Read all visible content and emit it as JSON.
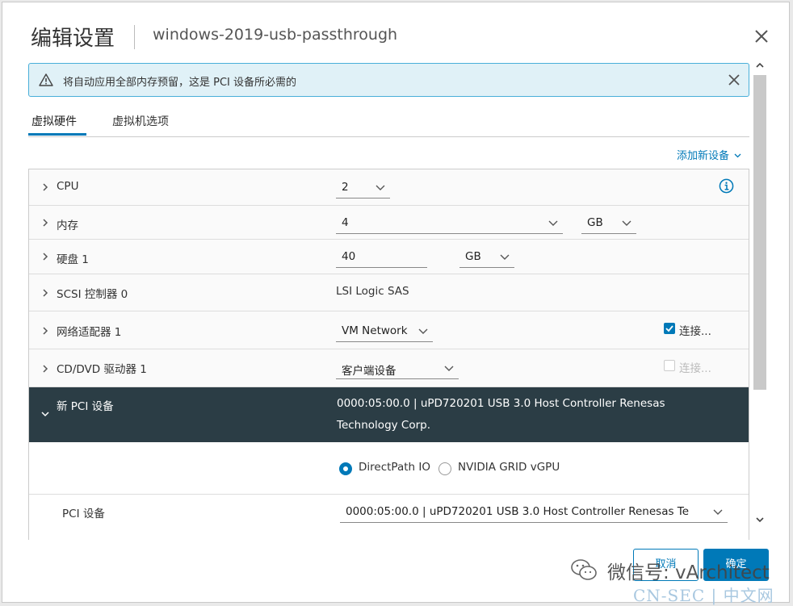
{
  "dialog": {
    "title": "编辑设置",
    "vm_name": "windows-2019-usb-passthrough"
  },
  "alert": {
    "message": "将自动应用全部内存预留，这是 PCI 设备所必需的"
  },
  "tabs": [
    {
      "label": "虚拟硬件",
      "active": true
    },
    {
      "label": "虚拟机选项",
      "active": false
    }
  ],
  "add_device_label": "添加新设备",
  "hardware": {
    "cpu": {
      "label": "CPU",
      "value": "2"
    },
    "memory": {
      "label": "内存",
      "value": "4",
      "unit": "GB"
    },
    "disk": {
      "label": "硬盘 1",
      "value": "40",
      "unit": "GB"
    },
    "scsi": {
      "label": "SCSI 控制器 0",
      "value": "LSI Logic SAS"
    },
    "network": {
      "label": "网络适配器 1",
      "value": "VM Network",
      "connect_label": "连接...",
      "connected": true
    },
    "cddvd": {
      "label": "CD/DVD 驱动器 1",
      "value": "客户端设备",
      "connect_label": "连接...",
      "connected": false
    },
    "pci": {
      "label": "新 PCI 设备",
      "value_line1": "0000:05:00.0 | uPD720201 USB 3.0 Host Controller Renesas",
      "value_line2": "Technology Corp.",
      "mode_options": [
        "DirectPath IO",
        "NVIDIA GRID vGPU"
      ],
      "selected_mode": "DirectPath IO",
      "device_label": "PCI 设备",
      "device_value": "0000:05:00.0 | uPD720201 USB 3.0 Host Controller Renesas Te"
    }
  },
  "buttons": {
    "cancel": "取消",
    "ok": "确定"
  },
  "watermark": {
    "wechat": "微信号: vArchitect",
    "site": "CN-SEC | 中文网"
  },
  "colors": {
    "accent": "#0079b8",
    "selected_row": "#2b3d45",
    "alert_bg": "#e0f1f7"
  }
}
